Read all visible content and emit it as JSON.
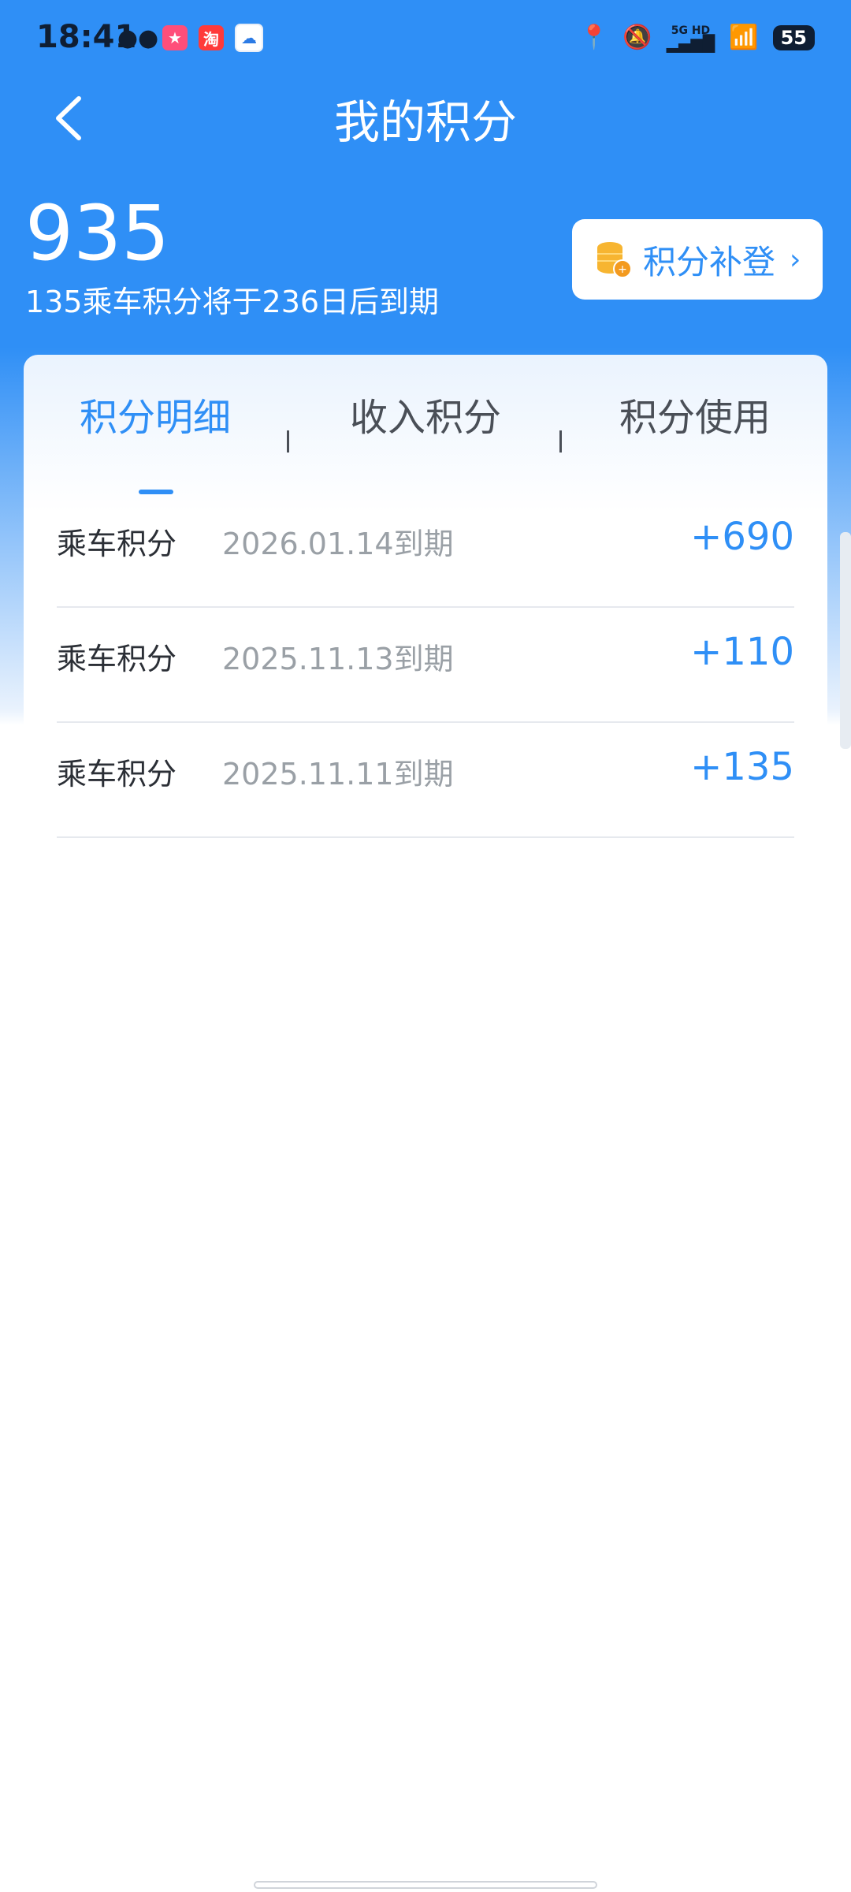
{
  "status_bar": {
    "time": "18:41",
    "app_icons": [
      "wechat-icon",
      "red-app-icon",
      "taobao-icon",
      "cloud-app-icon"
    ],
    "signal_label_top": "5G HD",
    "battery": "55"
  },
  "header": {
    "title": "我的积分"
  },
  "summary": {
    "total_points": "935",
    "expire_note": "135乘车积分将于236日后到期",
    "makeup_button": "积分补登"
  },
  "tabs": [
    {
      "label": "积分明细",
      "active": true
    },
    {
      "label": "收入积分",
      "active": false
    },
    {
      "label": "积分使用",
      "active": false
    }
  ],
  "entries": [
    {
      "label": "乘车积分",
      "date": "2026.01.14到期",
      "amount": "+690"
    },
    {
      "label": "乘车积分",
      "date": "2025.11.13到期",
      "amount": "+110"
    },
    {
      "label": "乘车积分",
      "date": "2025.11.11到期",
      "amount": "+135"
    }
  ],
  "colors": {
    "accent": "#2f8ff6",
    "text_primary": "#2b2f36",
    "text_secondary": "#9aa0a6"
  }
}
